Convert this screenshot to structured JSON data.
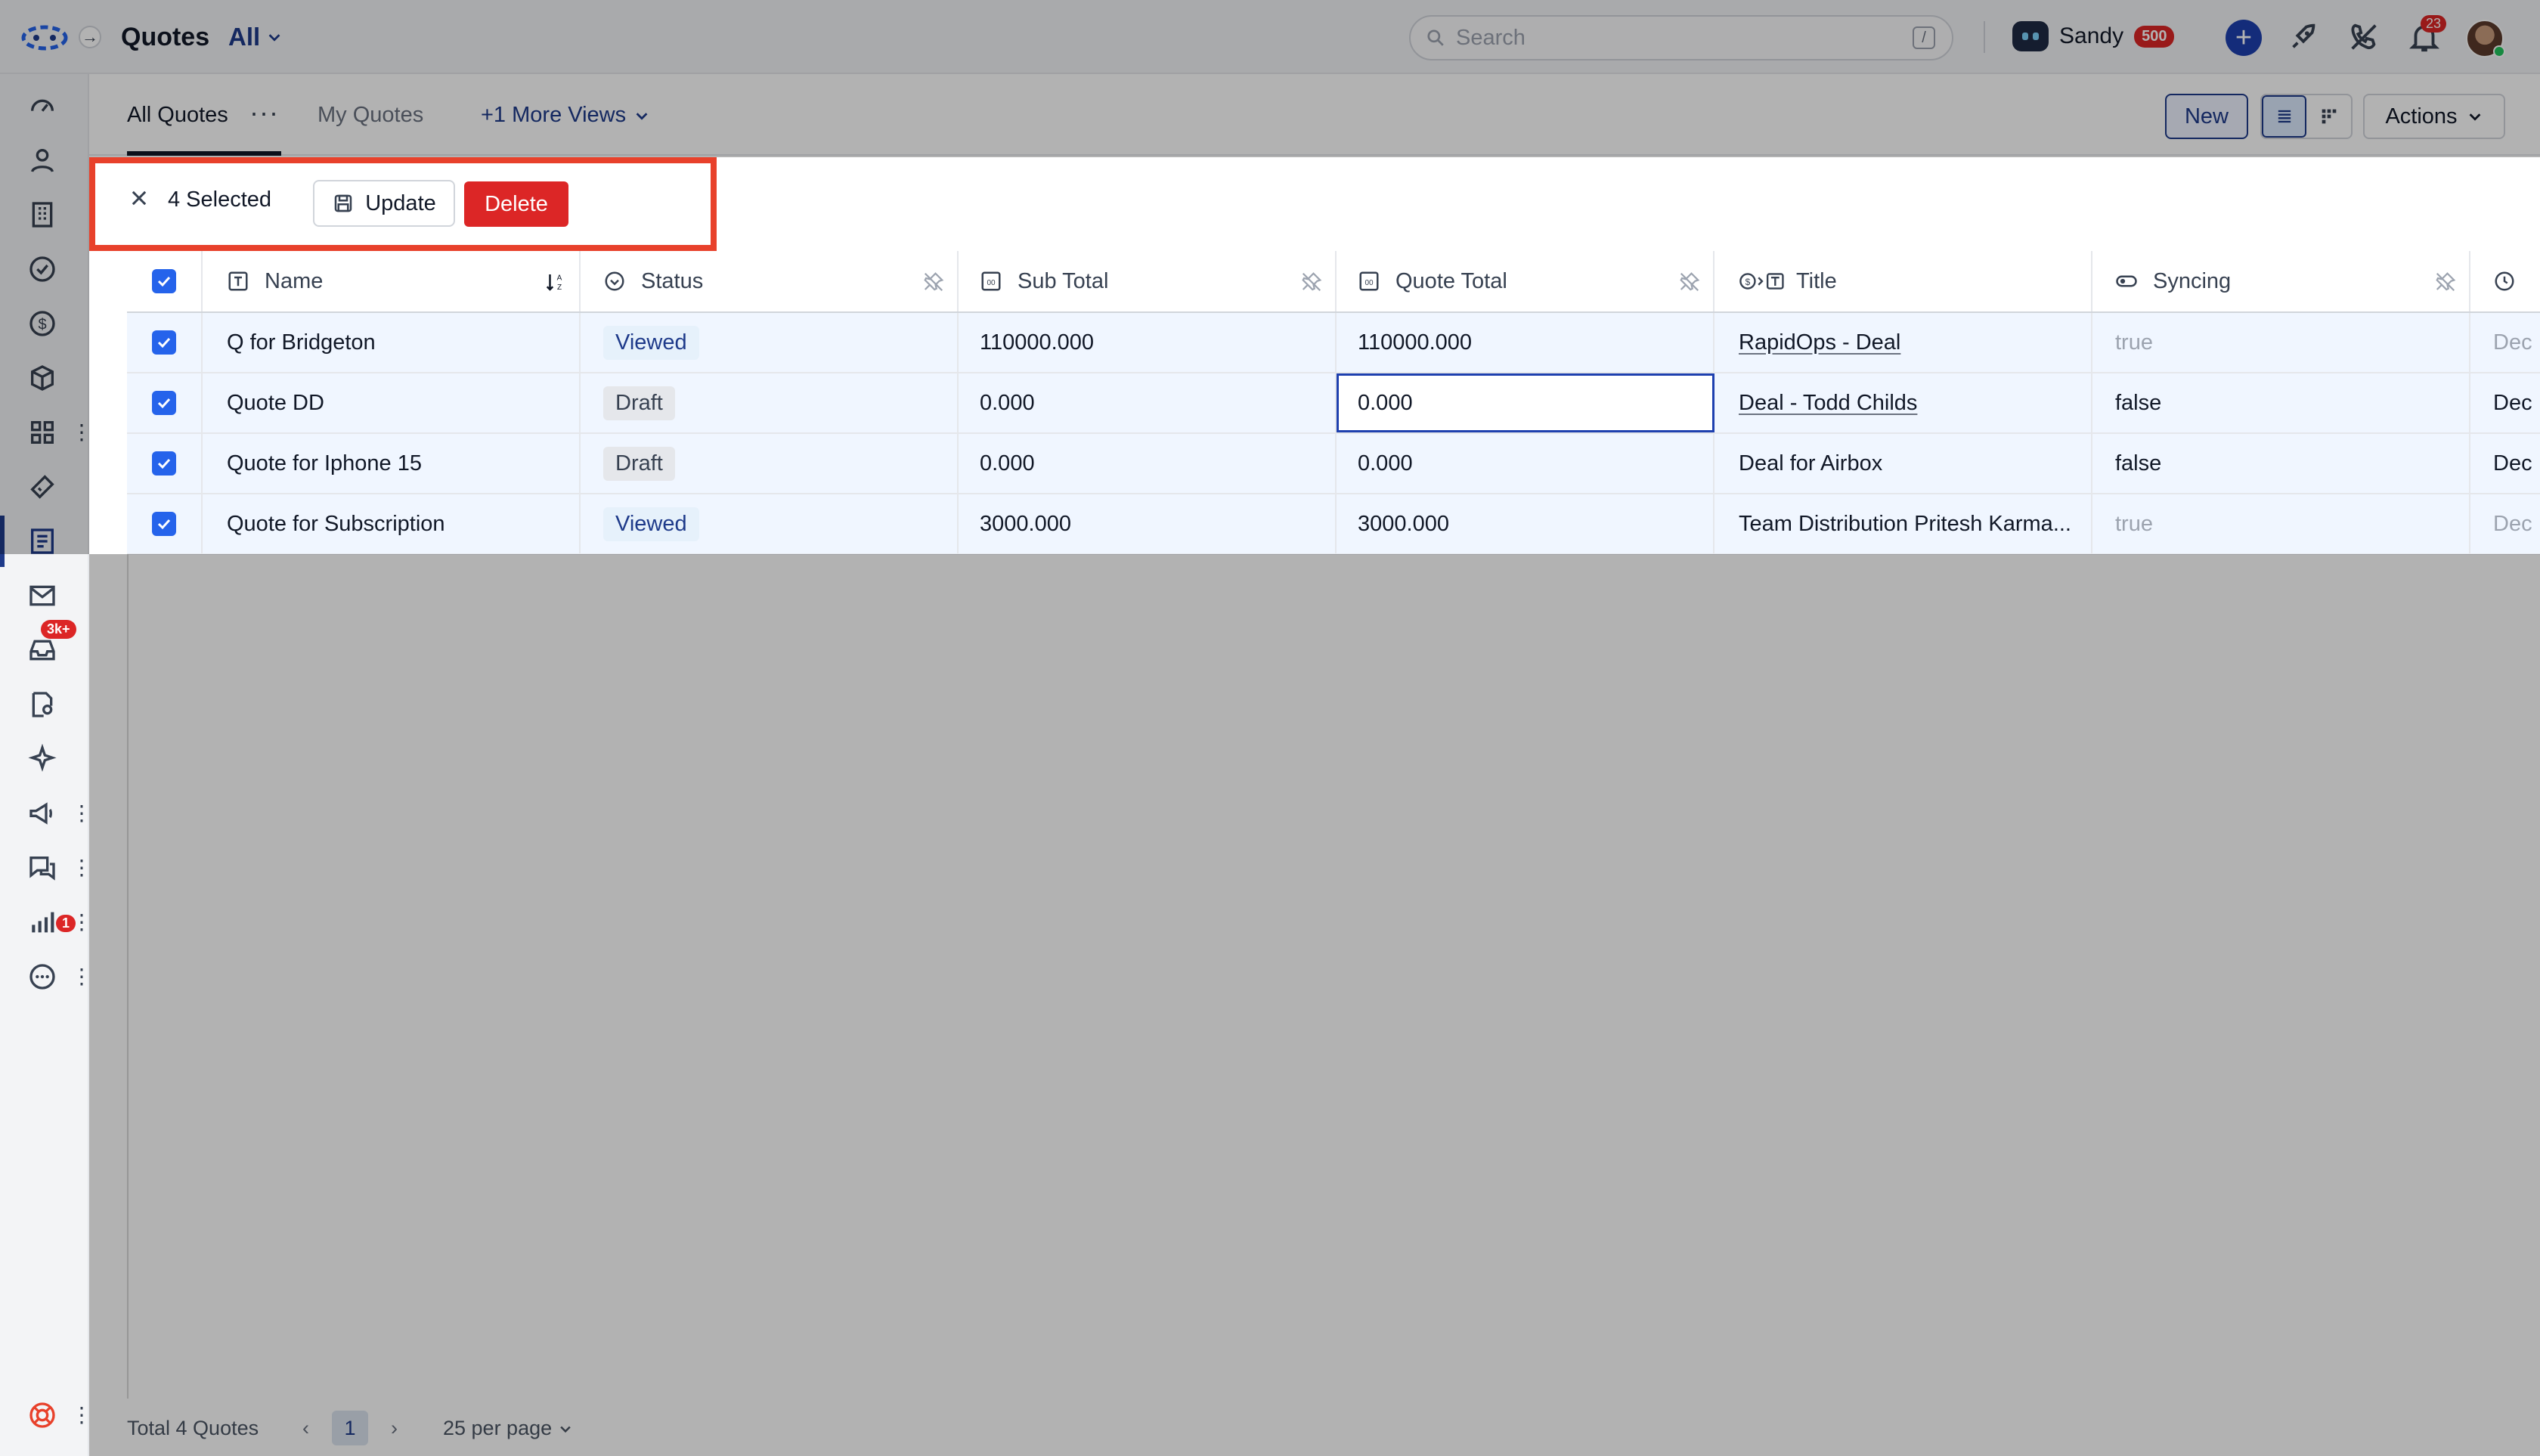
{
  "topbar": {
    "app_title": "Quotes",
    "view_selector": "All",
    "search_placeholder": "Search",
    "search_shortcut": "/",
    "user_name": "Sandy",
    "user_credits": "500",
    "notification_count": "23"
  },
  "sidebar": {
    "inbox_badge": "3k+",
    "chat_badge": "1"
  },
  "views": {
    "tabs": [
      "All Quotes",
      "My Quotes"
    ],
    "more_views": "+1 More Views",
    "new_label": "New",
    "actions_label": "Actions"
  },
  "selection": {
    "count_label": "4 Selected",
    "update_label": "Update",
    "delete_label": "Delete"
  },
  "table": {
    "columns": [
      "Name",
      "Status",
      "Sub Total",
      "Quote Total",
      "Title",
      "Syncing"
    ],
    "rows": [
      {
        "name": "Q for Bridgeton",
        "status": "Viewed",
        "sub_total": "110000.000",
        "quote_total": "110000.000",
        "title": "RapidOps - Deal",
        "syncing": "true",
        "extra": "Dec"
      },
      {
        "name": "Quote DD",
        "status": "Draft",
        "sub_total": "0.000",
        "quote_total": "0.000",
        "title": "Deal - Todd Childs",
        "syncing": "false",
        "extra": "Dec"
      },
      {
        "name": "Quote for Iphone 15",
        "status": "Draft",
        "sub_total": "0.000",
        "quote_total": "0.000",
        "title": "Deal for Airbox",
        "syncing": "false",
        "extra": "Dec"
      },
      {
        "name": "Quote for Subscription",
        "status": "Viewed",
        "sub_total": "3000.000",
        "quote_total": "3000.000",
        "title": "Team Distribution Pritesh Karma...",
        "syncing": "true",
        "extra": "Dec"
      }
    ]
  },
  "footer": {
    "total": "Total 4 Quotes",
    "page": "1",
    "per_page": "25 per page"
  },
  "colors": {
    "accent": "#1e3a8a",
    "danger": "#dc2626",
    "highlight": "#e8412b"
  }
}
